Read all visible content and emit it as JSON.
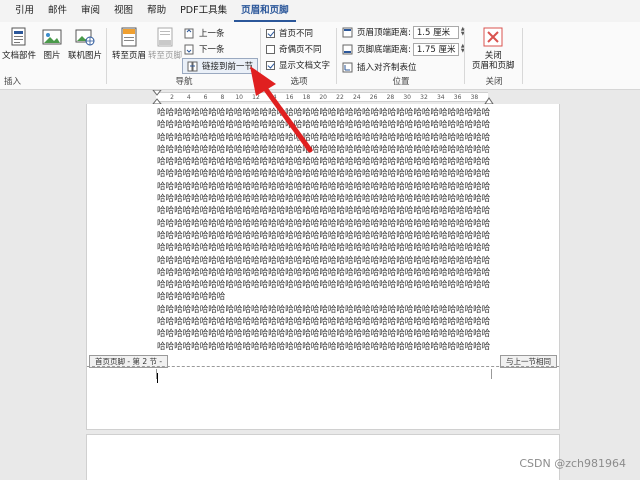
{
  "tabs": [
    "引用",
    "邮件",
    "审阅",
    "视图",
    "帮助",
    "PDF工具集",
    "页眉和页脚"
  ],
  "active_tab_index": 6,
  "ribbon": {
    "insert_group": {
      "label": "插入",
      "doc_parts": "文档部件",
      "picture": "图片",
      "online_picture": "联机图片"
    },
    "nav_group": {
      "label": "导航",
      "goto_header": "转至页眉",
      "goto_footer": "转至页脚",
      "previous": "上一条",
      "next": "下一条",
      "link_previous": "链接到前一节"
    },
    "options_group": {
      "label": "选项",
      "different_first_page": "首页不同",
      "different_odd_even": "奇偶页不同",
      "show_document_text": "显示文档文字",
      "different_first_page_checked": true,
      "different_odd_even_checked": false,
      "show_document_text_checked": true
    },
    "position_group": {
      "label": "位置",
      "header_top_label": "页眉顶端距离:",
      "header_top_value": "1.5 厘米",
      "footer_bottom_label": "页脚底端距离:",
      "footer_bottom_value": "1.75 厘米",
      "insert_align_tab": "插入对齐制表位"
    },
    "close_group": {
      "label": "关闭",
      "close_button": "关闭\n页眉和页脚"
    }
  },
  "ruler_ticks": [
    "2",
    "4",
    "6",
    "8",
    "10",
    "12",
    "14",
    "16",
    "18",
    "20",
    "22",
    "24",
    "26",
    "28",
    "30",
    "32",
    "34",
    "36",
    "38"
  ],
  "document": {
    "full_line": "哈哈哈哈哈哈哈哈哈哈哈哈哈哈哈哈哈哈哈哈哈哈哈哈哈哈哈哈哈哈哈哈哈哈哈哈哈哈哈",
    "short_line": "哈哈哈哈哈哈哈哈",
    "footer_left_tag": "首页页脚 - 第 2 节 -",
    "footer_right_tag": "与上一节相同"
  },
  "watermark": "CSDN @zch981964",
  "colors": {
    "accent": "#2b579a",
    "arrow": "#e02020",
    "close_icon": "#d9534f"
  }
}
